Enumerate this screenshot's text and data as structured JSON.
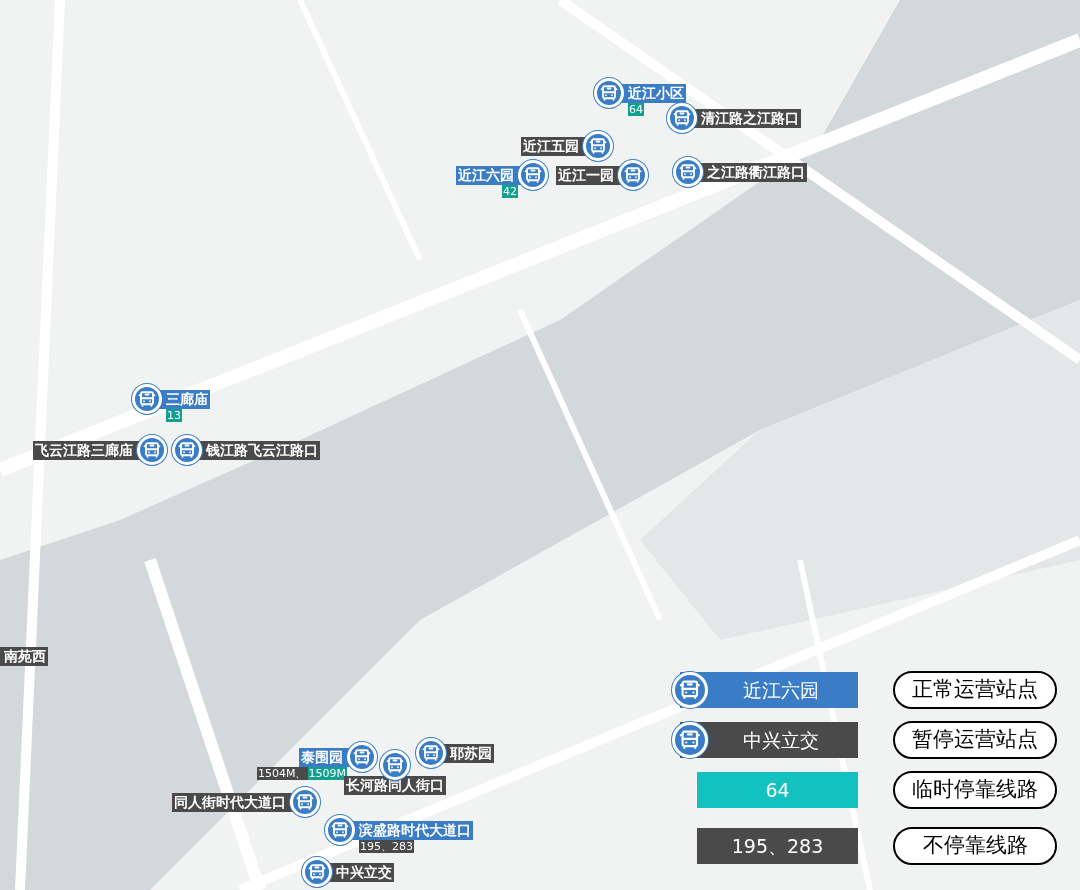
{
  "stops": [
    {
      "name": "近江小区",
      "suspended": false,
      "routes": [
        {
          "text": "64",
          "kind": "temporary"
        }
      ]
    },
    {
      "name": "清江路之江路口",
      "suspended": true
    },
    {
      "name": "近江五园",
      "suspended": true
    },
    {
      "name": "近江六园",
      "suspended": false,
      "routes": [
        {
          "text": "42",
          "kind": "temporary"
        }
      ]
    },
    {
      "name": "近江一园",
      "suspended": true
    },
    {
      "name": "之江路衢江路口",
      "suspended": true
    },
    {
      "name": "三廊庙",
      "suspended": false,
      "routes": [
        {
          "text": "13",
          "kind": "temporary"
        }
      ]
    },
    {
      "name": "飞云江路三廊庙",
      "suspended": true
    },
    {
      "name": "钱江路飞云江路口",
      "suspended": true
    },
    {
      "name": "南苑西",
      "suspended": true
    },
    {
      "name": "泰围园",
      "suspended": false,
      "routes": [
        {
          "text": "1504M、",
          "kind": "skipped"
        },
        {
          "text": "1509M",
          "kind": "temporary"
        }
      ]
    },
    {
      "name": "长河路同人街口",
      "suspended": true
    },
    {
      "name": "耶苏园",
      "suspended": true
    },
    {
      "name": "同人街时代大道口",
      "suspended": true
    },
    {
      "name": "滨盛路时代大道口",
      "suspended": false,
      "routes": [
        {
          "text": "195、283",
          "kind": "skipped"
        }
      ]
    },
    {
      "name": "中兴立交",
      "suspended": true
    }
  ],
  "legend": [
    {
      "kind": "normal_stop",
      "sample": "近江六园",
      "meaning": "正常运营站点"
    },
    {
      "kind": "suspended_stop",
      "sample": "中兴立交",
      "meaning": "暂停运营站点"
    },
    {
      "kind": "temporary_route",
      "sample": "64",
      "meaning": "临时停靠线路"
    },
    {
      "kind": "skipped_route",
      "sample": "195、283",
      "meaning": "不停靠线路"
    }
  ]
}
